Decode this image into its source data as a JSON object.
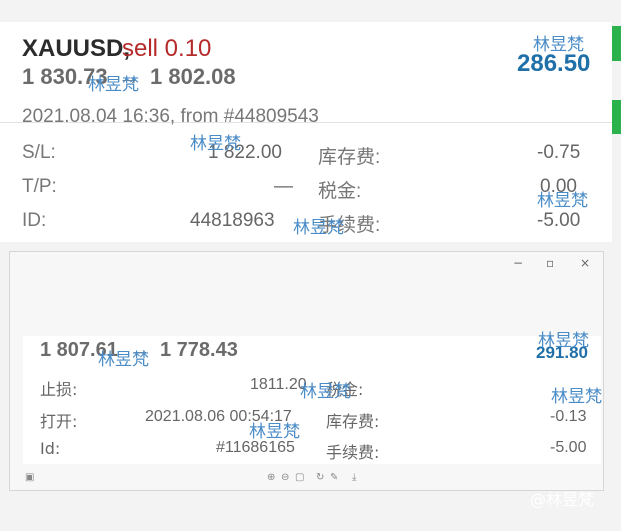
{
  "order": {
    "symbol": "XAUUSD,",
    "side": "sell 0.10",
    "price_from": "1 830.73",
    "arrow": "→",
    "price_to": "1 802.08",
    "profit": "286.50",
    "opened": "2021.08.04 16:36, from #44809543",
    "rows": [
      {
        "label": "S/L:",
        "value": "1 822.00",
        "label2": "库存费:",
        "value2": "-0.75"
      },
      {
        "label": "T/P:",
        "value": "—",
        "label2": "税金:",
        "value2": "0.00"
      },
      {
        "label": "ID:",
        "value": "44818963",
        "label2": "手续费:",
        "value2": "-5.00"
      }
    ]
  },
  "window": {
    "minimize": "−",
    "maximize": "▫",
    "close": "×"
  },
  "detail": {
    "price_from": "1 807.61",
    "arrow": "→",
    "price_to": "1 778.43",
    "profit": "291.80",
    "rows": [
      {
        "label": "止损:",
        "value": "1811.20",
        "label2": "税金:",
        "value2": ""
      },
      {
        "label": "打开:",
        "value": "2021.08.06 00:54:17",
        "label2": "库存费:",
        "value2": "-0.13"
      },
      {
        "label": "Id:",
        "value": "#11686165",
        "label2": "手续费:",
        "value2": "-5.00"
      }
    ]
  },
  "watermark": "林昱梵",
  "footer_text": "@林昱梵",
  "colors": {
    "profit": "#1f6fa8",
    "sell": "#b52a2a",
    "accent_green": "#2bb24c"
  }
}
